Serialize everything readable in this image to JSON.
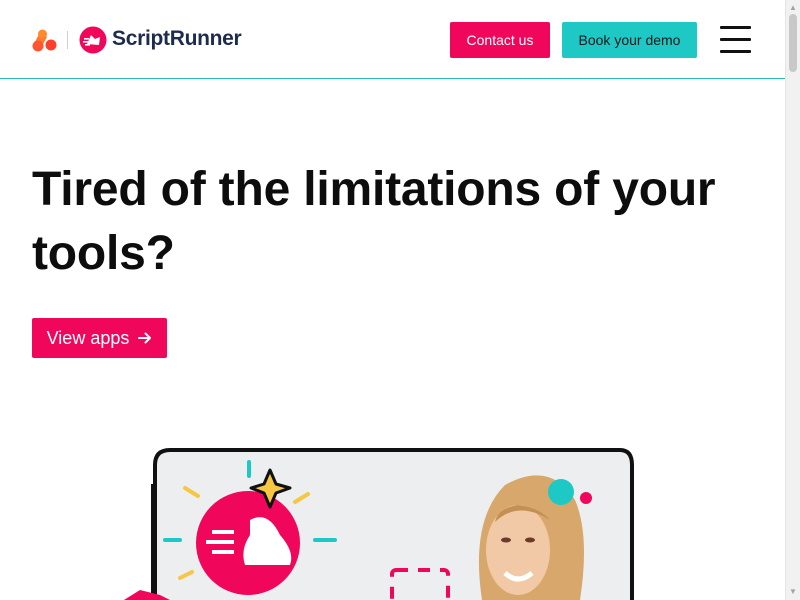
{
  "brand": {
    "adaptavist_icon": "adaptavist-logo-icon",
    "scriptrunner_icon": "scriptrunner-logo-icon",
    "name": "ScriptRunner"
  },
  "header": {
    "contact_label": "Contact us",
    "demo_label": "Book your demo",
    "menu_icon": "hamburger-menu-icon"
  },
  "hero": {
    "title": "Tired of the limitations of your tools?",
    "cta_label": "View apps",
    "cta_icon": "arrow-right-icon"
  },
  "colors": {
    "brand_pink": "#f0065a",
    "brand_teal": "#1ec8c5",
    "brand_orange": "#ff5630",
    "text_dark": "#0d0d0d",
    "header_border": "#2bb8b3"
  }
}
